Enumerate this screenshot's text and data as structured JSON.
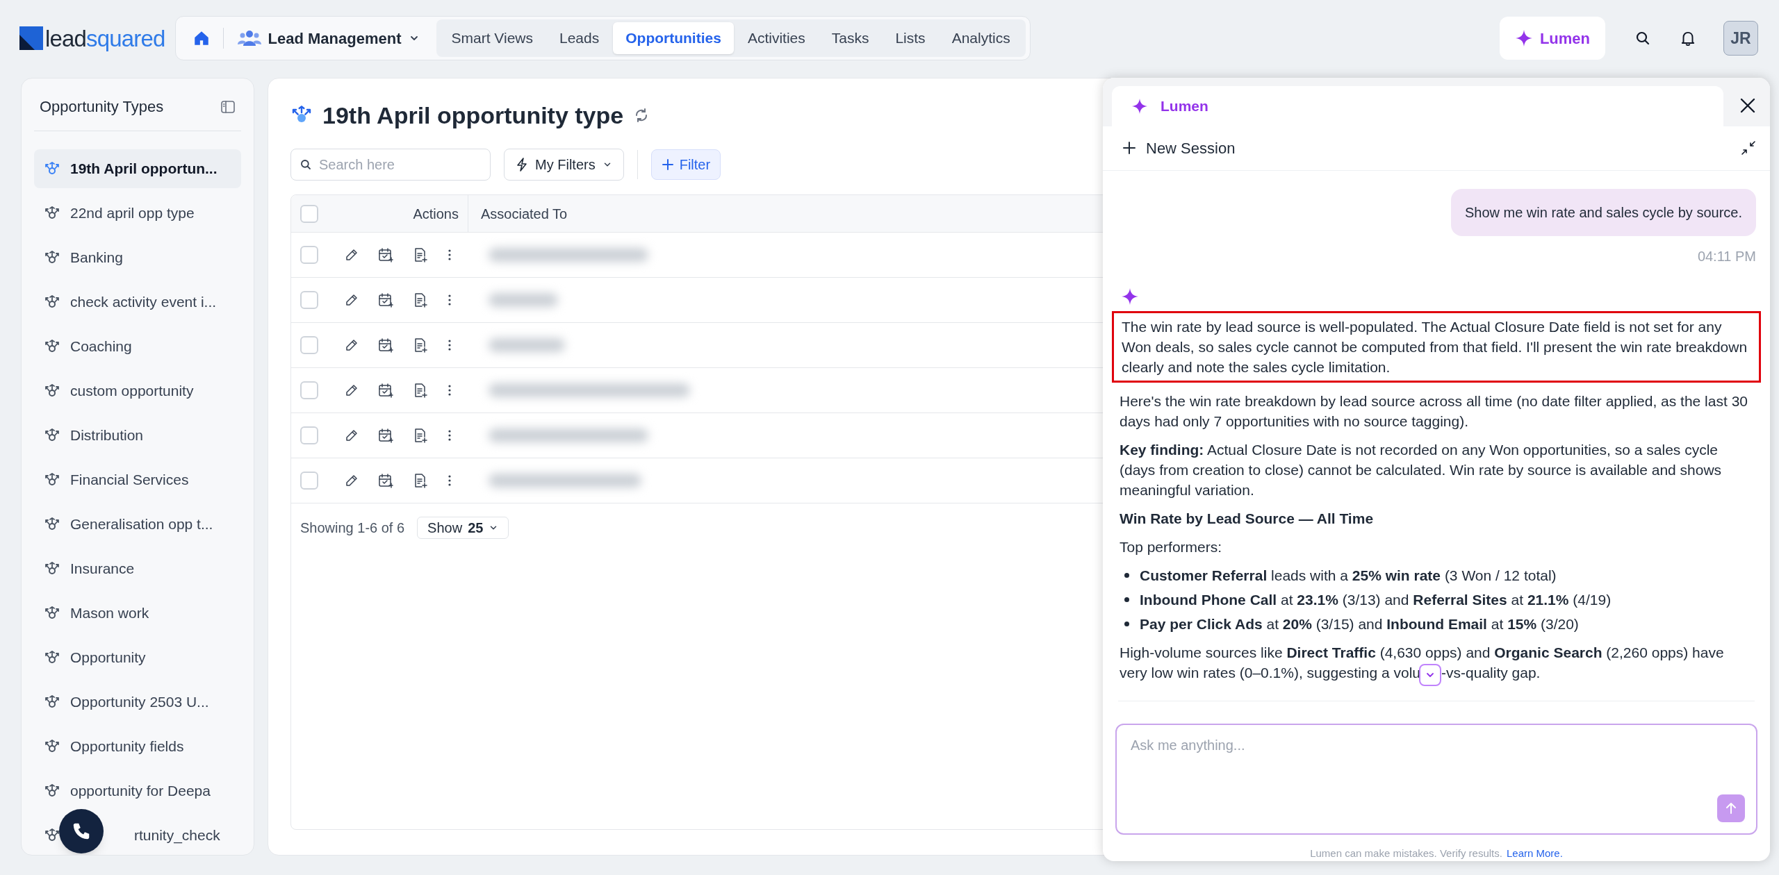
{
  "brand": {
    "part_1": "lead",
    "part_2": "squared"
  },
  "nav": {
    "module": "Lead Management",
    "tabs": [
      {
        "label": "Smart Views",
        "selected": false
      },
      {
        "label": "Leads",
        "selected": false
      },
      {
        "label": "Opportunities",
        "selected": true
      },
      {
        "label": "Activities",
        "selected": false
      },
      {
        "label": "Tasks",
        "selected": false
      },
      {
        "label": "Lists",
        "selected": false
      },
      {
        "label": "Analytics",
        "selected": false
      }
    ]
  },
  "header_actions": {
    "lumen": "Lumen",
    "avatar": "JR"
  },
  "sidebar": {
    "title": "Opportunity Types",
    "items": [
      {
        "label": "19th April opportun...",
        "selected": true
      },
      {
        "label": "22nd april opp type",
        "selected": false
      },
      {
        "label": "Banking",
        "selected": false
      },
      {
        "label": "check activity event i...",
        "selected": false
      },
      {
        "label": "Coaching",
        "selected": false
      },
      {
        "label": "custom opportunity",
        "selected": false
      },
      {
        "label": "Distribution",
        "selected": false
      },
      {
        "label": "Financial Services",
        "selected": false
      },
      {
        "label": "Generalisation opp t...",
        "selected": false
      },
      {
        "label": "Insurance",
        "selected": false
      },
      {
        "label": "Mason work",
        "selected": false
      },
      {
        "label": "Opportunity",
        "selected": false
      },
      {
        "label": "Opportunity 2503 U...",
        "selected": false
      },
      {
        "label": "Opportunity fields",
        "selected": false
      },
      {
        "label": "opportunity for Deepa",
        "selected": false
      },
      {
        "label": "rtunity_check",
        "selected": false
      }
    ]
  },
  "main": {
    "title": "19th April opportunity type",
    "search": {
      "placeholder": "Search here"
    },
    "my_filters": "My Filters",
    "filter": "Filter",
    "table": {
      "columns": [
        "Actions",
        "Associated To"
      ],
      "all_checked": false,
      "rows": [
        {
          "checked": false
        },
        {
          "checked": false
        },
        {
          "checked": false
        },
        {
          "checked": false
        },
        {
          "checked": false
        },
        {
          "checked": false
        }
      ]
    },
    "footer": {
      "showing": "Showing 1-6 of 6",
      "show_label": "Show",
      "show_value": "25"
    }
  },
  "lumen": {
    "tab": "Lumen",
    "new_session": "New Session",
    "user_message": "Show me win rate and sales cycle by source.",
    "time": "04:11 PM",
    "reply": [
      {
        "kind": "paragraph",
        "text": "The win rate by lead source is well-populated. The Actual Closure Date field is not set for any Won deals, so sales cycle cannot be computed from that field. I'll present the win rate breakdown clearly and note the sales cycle limitation.",
        "highlighted": true
      },
      {
        "kind": "paragraph",
        "text": "Here's the win rate breakdown by lead source across all time (no date filter applied, as the last 30 days had only 7 opportunities with no source tagging).",
        "highlighted": false
      },
      {
        "kind": "paragraph",
        "text": "**Key finding:** Actual Closure Date is not recorded on any Won opportunities, so a sales cycle (days from creation to close) cannot be calculated. Win rate by source is available and shows meaningful variation.",
        "highlighted": false
      },
      {
        "kind": "heading",
        "text": "Win Rate by Lead Source — All Time"
      },
      {
        "kind": "paragraph",
        "text": "Top performers:",
        "highlighted": false
      },
      {
        "kind": "list",
        "items": [
          "**Customer Referral** leads with a **25% win rate** (3 Won / 12 total)",
          "**Inbound Phone Call** at **23.1%** (3/13) and **Referral Sites** at **21.1%** (4/19)",
          "**Pay per Click Ads** at **20%** (3/15) and **Inbound Email** at **15%** (3/20)"
        ]
      },
      {
        "kind": "paragraph",
        "text": "High-volume sources like **Direct Traffic** (4,630 opps) and **Organic Search** (2,260 opps) have very low win rates (0–0.1%), suggesting a volu",
        "tail": "-vs-quality gap.",
        "highlighted": false
      }
    ],
    "input": {
      "placeholder": "Ask me anything..."
    },
    "disclaimer": "Lumen can make mistakes. Verify results.",
    "learn_more": "Learn More."
  }
}
